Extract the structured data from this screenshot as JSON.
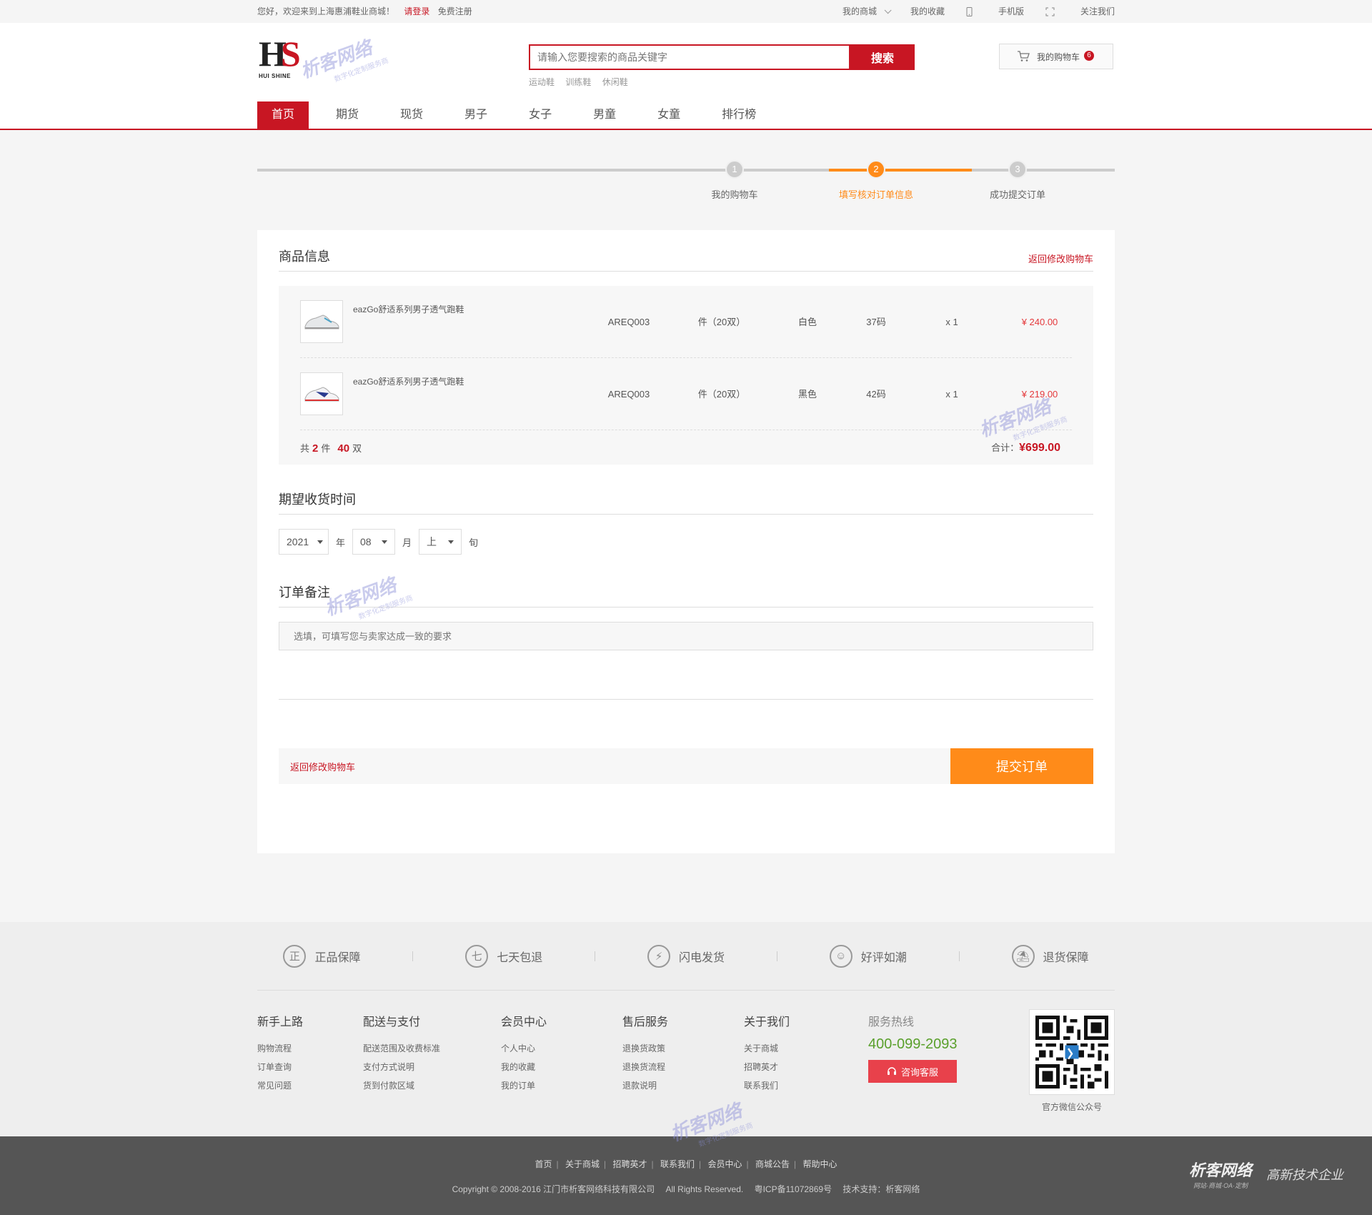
{
  "topbar": {
    "welcome": "您好，欢迎来到上海惠浦鞋业商城！",
    "login": "请登录",
    "register": "免费注册",
    "my_mall": "我的商城",
    "favorites": "我的收藏",
    "mobile": "手机版",
    "follow": "关注我们"
  },
  "header": {
    "logo_text": "HUI SHINE",
    "search_placeholder": "请输入您要搜索的商品关键字",
    "search_button": "搜索",
    "hot_words": [
      "运动鞋",
      "训练鞋",
      "休闲鞋"
    ],
    "cart_label": "我的购物车",
    "cart_count": "6"
  },
  "nav": [
    "首页",
    "期货",
    "现货",
    "男子",
    "女子",
    "男童",
    "女童",
    "排行榜"
  ],
  "steps": [
    {
      "num": "1",
      "label": "我的购物车"
    },
    {
      "num": "2",
      "label": "填写核对订单信息"
    },
    {
      "num": "3",
      "label": "成功提交订单"
    }
  ],
  "goods": {
    "title": "商品信息",
    "back_link": "返回修改购物车",
    "rows": [
      {
        "name": "eazGo舒适系列男子透气跑鞋",
        "code": "AREQ003",
        "unit": "件（20双）",
        "color": "白色",
        "size": "37码",
        "qty": "x 1",
        "price": "¥ 240.00"
      },
      {
        "name": "eazGo舒适系列男子透气跑鞋",
        "code": "AREQ003",
        "unit": "件（20双）",
        "color": "黑色",
        "size": "42码",
        "qty": "x 1",
        "price": "¥ 219.00"
      }
    ],
    "summary_prefix": "共",
    "summary_items": "2",
    "summary_mid": "件",
    "summary_pairs": "40",
    "summary_suffix": "双",
    "total_label": "合计：",
    "total_value": "¥699.00"
  },
  "delivery": {
    "title": "期望收货时间",
    "year": "2021",
    "year_unit": "年",
    "month": "08",
    "month_unit": "月",
    "period": "上",
    "period_unit": "旬"
  },
  "remark": {
    "title": "订单备注",
    "placeholder": "选填，可填写您与卖家达成一致的要求"
  },
  "submit": {
    "back_link": "返回修改购物车",
    "button": "提交订单"
  },
  "guarantees": [
    {
      "icon": "正",
      "label": "正品保障"
    },
    {
      "icon": "七",
      "label": "七天包退"
    },
    {
      "icon": "⚡",
      "label": "闪电发货"
    },
    {
      "icon": "☺",
      "label": "好评如潮"
    },
    {
      "icon": "⛱",
      "label": "退货保障"
    }
  ],
  "footer_cols": [
    {
      "title": "新手上路",
      "links": [
        "购物流程",
        "订单查询",
        "常见问题"
      ]
    },
    {
      "title": "配送与支付",
      "links": [
        "配送范围及收费标准",
        "支付方式说明",
        "货到付款区域"
      ]
    },
    {
      "title": "会员中心",
      "links": [
        "个人中心",
        "我的收藏",
        "我的订单"
      ]
    },
    {
      "title": "售后服务",
      "links": [
        "退换货政策",
        "退换货流程",
        "退款说明"
      ]
    },
    {
      "title": "关于我们",
      "links": [
        "关于商城",
        "招聘英才",
        "联系我们"
      ]
    }
  ],
  "hotline": {
    "title": "服务热线",
    "number": "400-099-2093",
    "button": "咨询客服"
  },
  "qr_label": "官方微信公众号",
  "bottom_links": [
    "首页",
    "关于商城",
    "招聘英才",
    "联系我们",
    "会员中心",
    "商城公告",
    "帮助中心"
  ],
  "copyright": "Copyright © 2008-2016 江门市析客网络科技有限公司",
  "rights": "All Rights Reserved.",
  "icp": "粤ICP备11072869号",
  "tech": "技术支持：析客网络",
  "brand": {
    "name": "析客网络",
    "sub": "网站·商城·OA·定制",
    "slogan": "高新技术企业"
  },
  "watermark": {
    "name": "析客网络",
    "sub": "数字化定制服务商"
  }
}
